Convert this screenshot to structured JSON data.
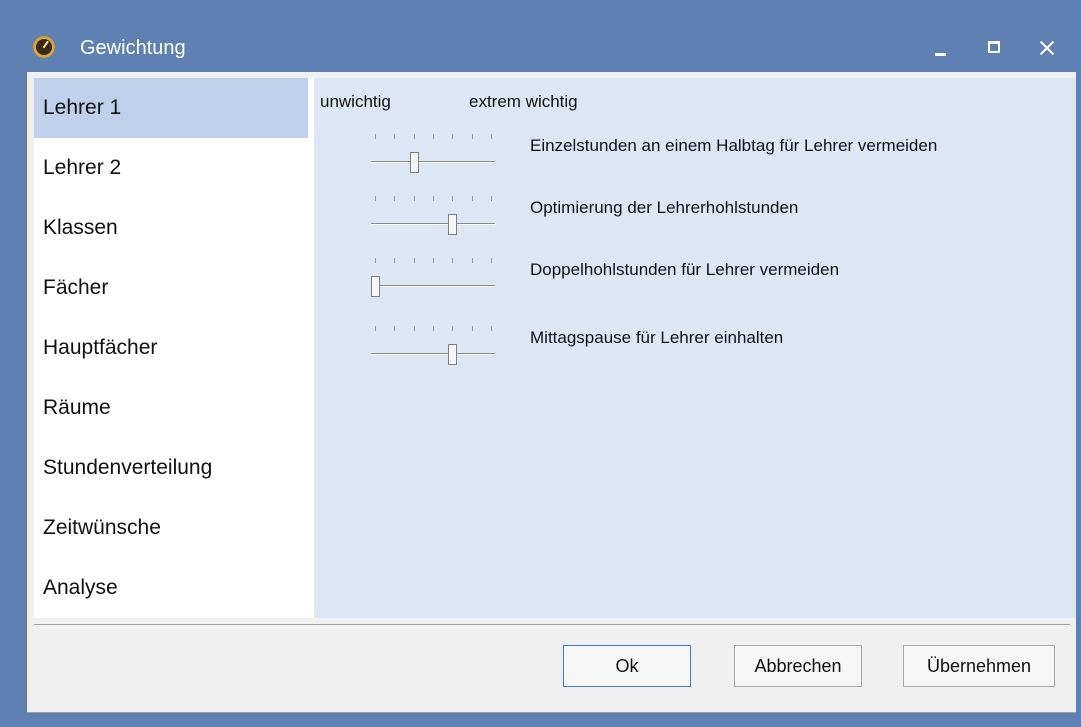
{
  "window": {
    "title": "Gewichtung",
    "app_icon": "clock-icon",
    "controls": [
      "minimize-icon",
      "maximize-icon",
      "close-icon"
    ]
  },
  "sidebar": {
    "items": [
      {
        "label": "Lehrer 1",
        "selected": true
      },
      {
        "label": "Lehrer 2",
        "selected": false
      },
      {
        "label": "Klassen",
        "selected": false
      },
      {
        "label": "Fächer",
        "selected": false
      },
      {
        "label": "Hauptfächer",
        "selected": false
      },
      {
        "label": "Räume",
        "selected": false
      },
      {
        "label": "Stundenverteilung",
        "selected": false
      },
      {
        "label": "Zeitwünsche",
        "selected": false
      },
      {
        "label": "Analyse",
        "selected": false
      }
    ]
  },
  "content": {
    "header_low": "unwichtig",
    "header_high": "extrem wichtig",
    "sliders": [
      {
        "label": "Einzelstunden an einem Halbtag für Lehrer vermeiden",
        "value": 2,
        "max": 6
      },
      {
        "label": "Optimierung der Lehrerhohlstunden",
        "value": 4,
        "max": 6
      },
      {
        "label": "Doppelhohlstunden für Lehrer vermeiden",
        "value": 0,
        "max": 6
      },
      {
        "label": "Mittagspause für Lehrer einhalten",
        "value": 4,
        "max": 6
      }
    ]
  },
  "buttons": {
    "ok": "Ok",
    "cancel": "Abbrechen",
    "apply": "Übernehmen"
  },
  "colors": {
    "titlebar": "#5f80b2",
    "selected_item": "#bfd0ea",
    "content_bg": "#dce6f4",
    "default_button_border": "#3d7ad6"
  }
}
